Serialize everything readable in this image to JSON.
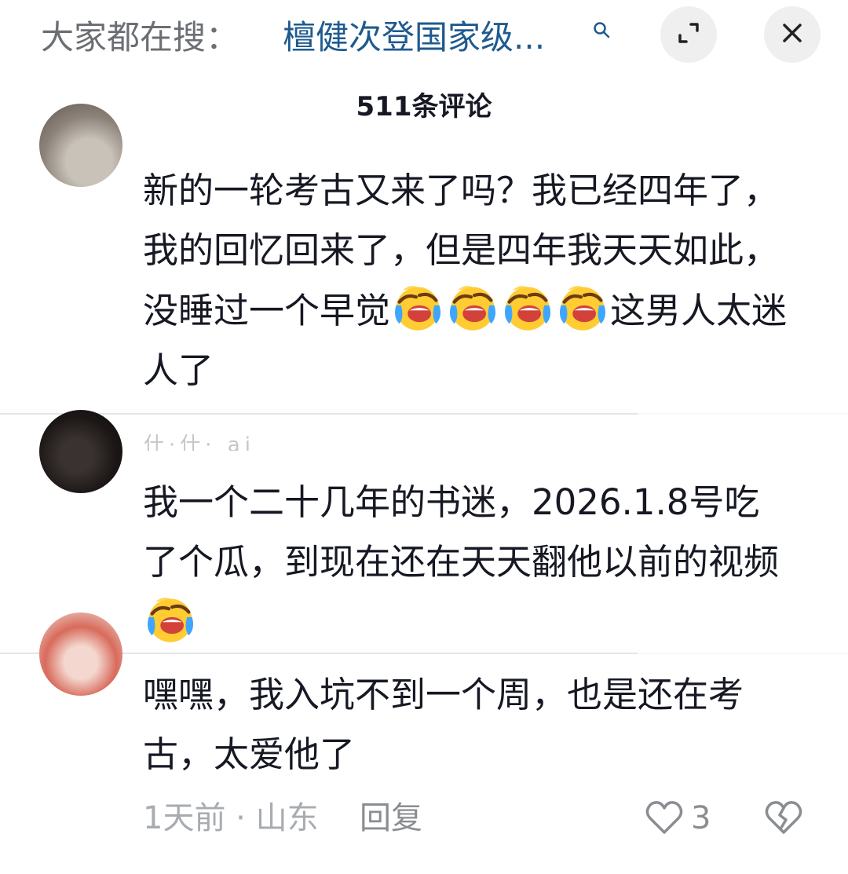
{
  "header": {
    "search_prefix": "大家都在搜：",
    "search_query": "檀健次登国家级...",
    "search_icon": "search-icon",
    "expand_icon": "collapse-expand-icon",
    "close_icon": "close-icon"
  },
  "comment_count": "511条评论",
  "comments": [
    {
      "segments": [
        "新的一轮考古又来了吗？我已经四年了，我的回忆回来了，但是四年我天天如此，没睡过一个早觉",
        "这男人太迷人了"
      ],
      "emoji": "crying-laughing-emoji"
    },
    {
      "username": "什·什·  ai",
      "segments": [
        "我一个二十几年的书迷，2026.1.8号吃了个瓜，到现在还在天天翻他以前的视频"
      ],
      "emoji": "crying-laughing-emoji"
    },
    {
      "segments": [
        "嘿嘿，我入坑不到一个周，也是还在考古，太爱他了"
      ],
      "meta": "1天前 · 山东",
      "reply_label": "回复",
      "like_count": "3"
    }
  ],
  "colors": {
    "link_blue": "#1f5a8e",
    "text_primary": "#161823",
    "text_secondary": "#a8abb0",
    "background": "#f7f8fa"
  }
}
